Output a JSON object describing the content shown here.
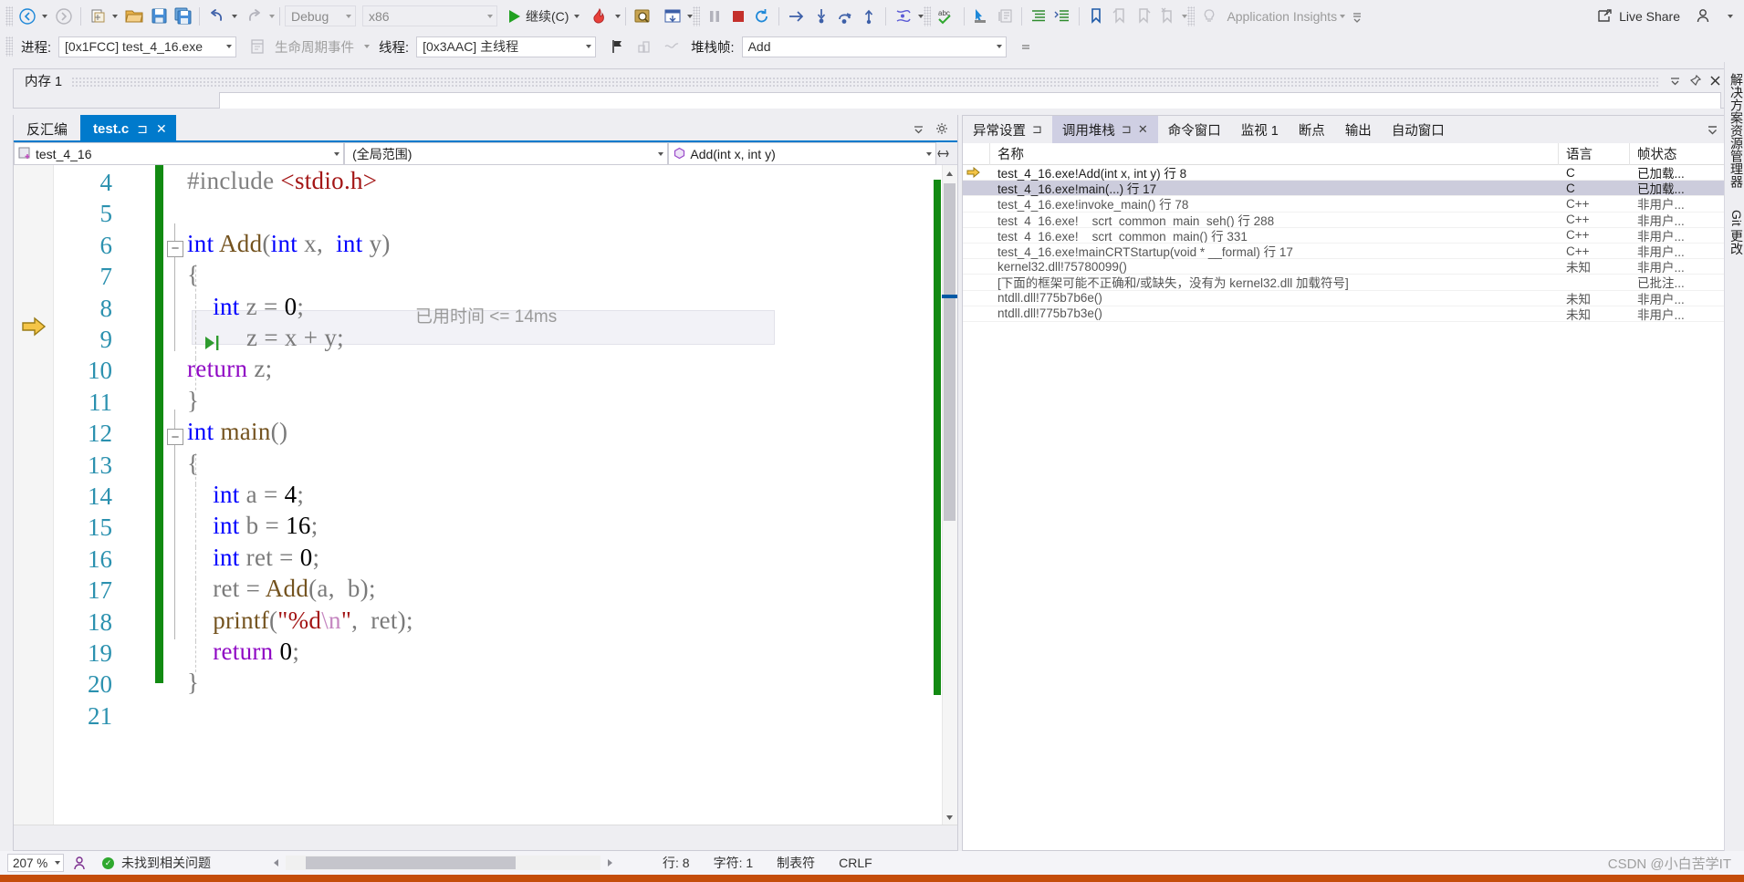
{
  "toolbar": {
    "back_icon": "back-arrow-icon",
    "forward_icon": "forward-arrow-icon",
    "new_item_icon": "new-item-icon",
    "open_icon": "open-folder-icon",
    "save_icon": "save-icon",
    "save_all_icon": "save-all-icon",
    "undo_icon": "undo-icon",
    "redo_icon": "redo-icon",
    "config_value": "Debug",
    "platform_value": "x86",
    "continue_label": "继续(C)",
    "hot_reload_icon": "hot-reload-icon",
    "attach_icon": "attach-to-process-icon",
    "breakall_icon": "break-all-icon",
    "pause_icon": "pause-icon",
    "stop_icon": "stop-icon",
    "restart_icon": "restart-icon",
    "show_next_icon": "show-next-statement-icon",
    "step_over_icon": "step-over-icon",
    "step_into_icon": "step-into-icon",
    "step_out_icon": "step-out-icon",
    "threads_icon": "threads-icon",
    "spell_icon": "spell-check-icon",
    "pointer_icon": "pointer-select-icon",
    "comment_icon": "comment-icon",
    "indent_icon": "indent-icon",
    "outdent_icon": "outdent-icon",
    "bookmark_icon": "bookmark-icon",
    "prev_bookmark_icon": "previous-bookmark-icon",
    "next_bookmark_icon": "next-bookmark-icon",
    "clear_bookmark_icon": "clear-bookmarks-icon",
    "lightbulb_icon": "lightbulb-icon",
    "app_insights_label": "Application Insights",
    "live_share_label": "Live Share",
    "live_share_icon": "live-share-icon",
    "account_icon": "user-account-icon",
    "overflow_icon": "toolbar-overflow-icon"
  },
  "debugbar": {
    "process_label": "进程:",
    "process_value": "[0x1FCC] test_4_16.exe",
    "lifecycle_label": "生命周期事件",
    "lifecycle_icon": "lifecycle-events-icon",
    "thread_label": "线程:",
    "thread_value": "[0x3AAC] 主线程",
    "flag_icon": "flag-icon",
    "stack_icon": "stack-icon",
    "link_icon": "link-icon",
    "frame_label": "堆栈帧:",
    "frame_value": "Add"
  },
  "memory_pane": {
    "title": "内存 1",
    "pin_icon": "pin-icon",
    "dropdown_icon": "chevron-down-icon",
    "close_icon": "close-icon"
  },
  "editor": {
    "tabs": [
      {
        "label": "反汇编",
        "active": false
      },
      {
        "label": "test.c",
        "active": true
      }
    ],
    "tab_pin_icon": "pin-icon",
    "tab_close_icon": "close-icon",
    "tabs_dropdown_icon": "chevron-down-icon",
    "tabs_settings_icon": "gear-icon",
    "nav_project": "test_4_16",
    "nav_project_icon": "project-icon",
    "nav_scope": "(全局范围)",
    "nav_member": "Add(int x, int y)",
    "nav_member_icon": "method-icon",
    "split_icon": "split-view-icon",
    "current_line": 8,
    "breakpoint_line": 9,
    "elapsed_time": "已用时间 <= 14ms",
    "lines": [
      {
        "num": "4",
        "html": "<span class='pp'>#include </span><span class='inc'>&lt;stdio.h&gt;</span>",
        "fold": "",
        "guide": false
      },
      {
        "num": "5",
        "html": "",
        "fold": "",
        "guide": false
      },
      {
        "num": "6",
        "html": "<span class='kw'>int</span> <span class='fn'>Add</span><span class='punct'>(</span><span class='kw'>int</span> <span class='punct'>x,</span>  <span class='kw'>int</span> <span class='punct'>y)</span>",
        "fold": "−",
        "guide": false
      },
      {
        "num": "7",
        "html": "<span class='punct'>{</span>",
        "fold": "",
        "guide": true
      },
      {
        "num": "8",
        "html": "    <span class='kw'>int</span> <span class='punct'>z = </span><span class='num'>0</span><span class='punct'>;</span>",
        "fold": "",
        "guide": true
      },
      {
        "num": "9",
        "html": "<span class='punct'>z = x + y;</span>",
        "fold": "",
        "guide": true
      },
      {
        "num": "10",
        "html": "<span class='ctrl'>return</span> <span class='punct'>z;</span>",
        "fold": "",
        "guide": true
      },
      {
        "num": "11",
        "html": "<span class='punct'>}</span>",
        "fold": "",
        "guide": false
      },
      {
        "num": "12",
        "html": "<span class='kw'>int</span> <span class='fn'>main</span><span class='punct'>()</span>",
        "fold": "−",
        "guide": false
      },
      {
        "num": "13",
        "html": "<span class='punct'>{</span>",
        "fold": "",
        "guide": true
      },
      {
        "num": "14",
        "html": "    <span class='kw'>int</span> <span class='punct'>a = </span><span class='num'>4</span><span class='punct'>;</span>",
        "fold": "",
        "guide": true
      },
      {
        "num": "15",
        "html": "    <span class='kw'>int</span> <span class='punct'>b = </span><span class='num'>16</span><span class='punct'>;</span>",
        "fold": "",
        "guide": true
      },
      {
        "num": "16",
        "html": "    <span class='kw'>int</span> <span class='punct'>ret = </span><span class='num'>0</span><span class='punct'>;</span>",
        "fold": "",
        "guide": true
      },
      {
        "num": "17",
        "html": "    <span class='punct'>ret = </span><span class='fn'>Add</span><span class='punct'>(a,  b);</span>",
        "fold": "",
        "guide": true
      },
      {
        "num": "18",
        "html": "    <span class='fn'>printf</span><span class='punct'>(</span><span class='str'>\"%d</span><span class='esc'>\\n</span><span class='str'>\"</span><span class='punct'>,  ret);</span>",
        "fold": "",
        "guide": true
      },
      {
        "num": "19",
        "html": "    <span class='ctrl'>return</span> <span class='num'>0</span><span class='punct'>;</span>",
        "fold": "",
        "guide": true
      },
      {
        "num": "20",
        "html": "<span class='punct'>}</span>",
        "fold": "",
        "guide": false
      },
      {
        "num": "21",
        "html": "",
        "fold": "",
        "guide": false
      }
    ]
  },
  "callstack": {
    "tabs": [
      {
        "label": "异常设置",
        "active": false,
        "pin": true,
        "close": false
      },
      {
        "label": "调用堆栈",
        "active": true,
        "pin": true,
        "close": true
      },
      {
        "label": "命令窗口",
        "active": false,
        "pin": false,
        "close": false
      },
      {
        "label": "监视 1",
        "active": false,
        "pin": false,
        "close": false
      },
      {
        "label": "断点",
        "active": false,
        "pin": false,
        "close": false
      },
      {
        "label": "输出",
        "active": false,
        "pin": false,
        "close": false
      },
      {
        "label": "自动窗口",
        "active": false,
        "pin": false,
        "close": false
      }
    ],
    "overflow_icon": "chevron-down-icon",
    "columns": {
      "name": "名称",
      "language": "语言",
      "state": "帧状态"
    },
    "rows": [
      {
        "marker": "current",
        "name": "test_4_16.exe!Add(int x, int y) 行 8",
        "lang": "C",
        "state": "已加载...",
        "selected": false
      },
      {
        "marker": "",
        "name": "test_4_16.exe!main(...) 行 17",
        "lang": "C",
        "state": "已加载...",
        "selected": true
      },
      {
        "marker": "",
        "name": "test_4_16.exe!invoke_main() 行 78",
        "lang": "C++",
        "state": "非用户...",
        "selected": false
      },
      {
        "marker": "",
        "name": "test_4_16.exe!__scrt_common_main_seh() 行 288",
        "lang": "C++",
        "state": "非用户...",
        "selected": false
      },
      {
        "marker": "",
        "name": "test_4_16.exe!__scrt_common_main() 行 331",
        "lang": "C++",
        "state": "非用户...",
        "selected": false
      },
      {
        "marker": "",
        "name": "test_4_16.exe!mainCRTStartup(void * __formal) 行 17",
        "lang": "C++",
        "state": "非用户...",
        "selected": false
      },
      {
        "marker": "",
        "name": "kernel32.dll!75780099()",
        "lang": "未知",
        "state": "非用户...",
        "selected": false
      },
      {
        "marker": "",
        "name": "[下面的框架可能不正确和/或缺失，没有为 kernel32.dll 加载符号]",
        "lang": "",
        "state": "已批注...",
        "selected": false
      },
      {
        "marker": "",
        "name": "ntdll.dll!775b7b6e()",
        "lang": "未知",
        "state": "非用户...",
        "selected": false
      },
      {
        "marker": "",
        "name": "ntdll.dll!775b7b3e()",
        "lang": "未知",
        "state": "非用户...",
        "selected": false
      }
    ]
  },
  "vertical_tabs": [
    {
      "label": "解决方案资源管理器"
    },
    {
      "label": "Git 更改"
    }
  ],
  "statusbar": {
    "zoom": "207 %",
    "zoom_caret_icon": "chevron-down-icon",
    "feedback_icon": "feedback-icon",
    "issues_icon": "check-circle-icon",
    "issues_label": "未找到相关问题",
    "scroll_left_icon": "scroll-left-icon",
    "scroll_right_icon": "scroll-right-icon",
    "line_label": "行: 8",
    "col_label": "字符: 1",
    "tabs_label": "制表符",
    "eol_label": "CRLF",
    "watermark": "CSDN @小白苦学IT"
  },
  "colors": {
    "accent_blue": "#007ACC",
    "tab_selected": "#CCCCDC",
    "change_bar_green": "#128A12",
    "orange_bar": "#C44D0A",
    "chrome": "#EEEEF2"
  }
}
